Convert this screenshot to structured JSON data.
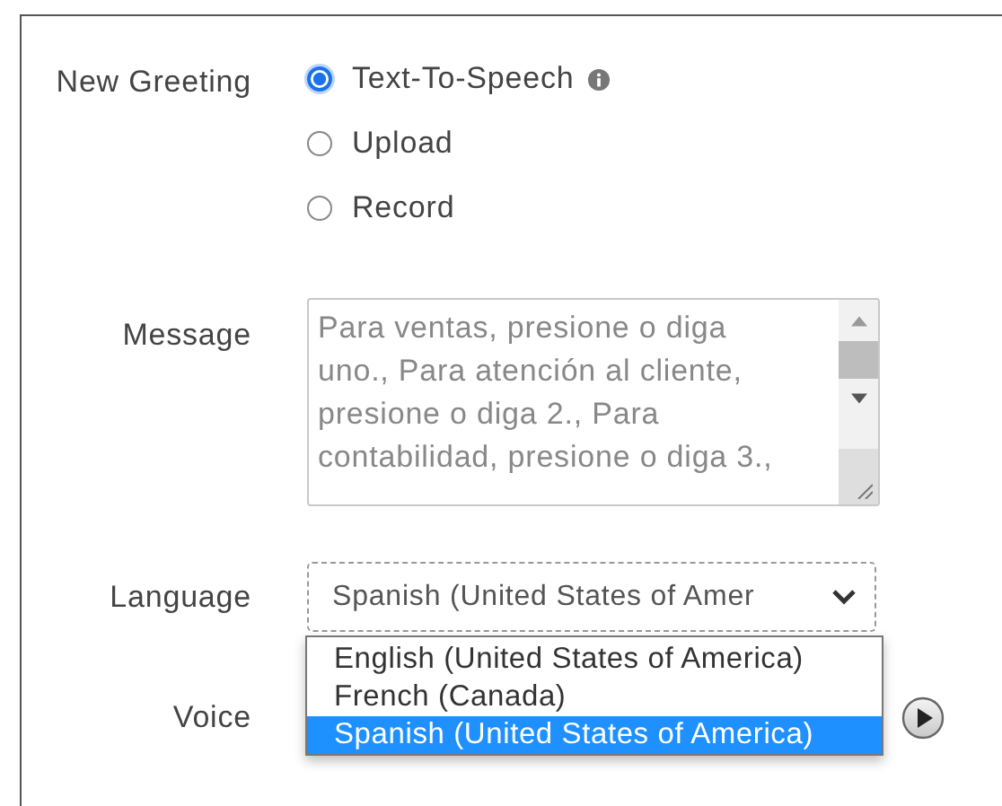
{
  "greeting": {
    "label": "New Greeting",
    "options": [
      {
        "label": "Text-To-Speech",
        "selected": true,
        "info": true
      },
      {
        "label": "Upload",
        "selected": false,
        "info": false
      },
      {
        "label": "Record",
        "selected": false,
        "info": false
      }
    ]
  },
  "message": {
    "label": "Message",
    "value": "Para ventas, presione o diga uno., Para atención al cliente, presione o diga 2., Para contabilidad, presione o diga 3.,"
  },
  "language": {
    "label": "Language",
    "value": "Spanish (United States of Amer",
    "expanded": true,
    "options": [
      {
        "label": "English (United States of America)",
        "selected": false
      },
      {
        "label": "French (Canada)",
        "selected": false
      },
      {
        "label": "Spanish (United States of America)",
        "selected": true
      }
    ]
  },
  "voice": {
    "label": "Voice"
  }
}
